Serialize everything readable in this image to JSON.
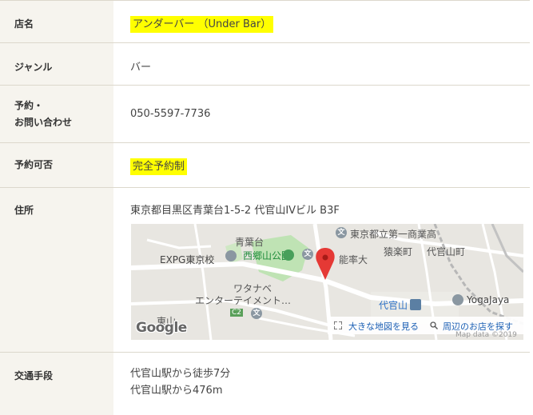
{
  "rows": {
    "shop_name": {
      "label": "店名",
      "value": "アンダーバー （Under Bar）"
    },
    "genre": {
      "label": "ジャンル",
      "value": "バー"
    },
    "reservation": {
      "label_line1": "予約・",
      "label_line2": "お問い合わせ",
      "value": "050-5597-7736"
    },
    "availability": {
      "label": "予約可否",
      "value": "完全予約制"
    },
    "address": {
      "label": "住所",
      "value": "東京都目黒区青葉台1-5-2 代官山IVビル B3F"
    },
    "access": {
      "label": "交通手段",
      "line1": "代官山駅から徒歩7分",
      "line2": "代官山駅から476m"
    }
  },
  "map": {
    "labels": {
      "aobadai": "青葉台",
      "saigoyama_park": "西郷山公園",
      "expg": "EXPG東京校",
      "watanabe_line1": "ワタナベ",
      "watanabe_line2": "エンターテイメント…",
      "higashiyama": "東山",
      "daiichi_shogyo": "東京都立第一商業高",
      "sarugakucho": "猿楽町",
      "daikanyamacho": "代官山町",
      "nouritsu": "能率大",
      "daikanyama_station": "代官山",
      "yogajaya": "YogaJaya",
      "route_c2": "C2",
      "poi_glyph": "文"
    },
    "google": "Google",
    "larger_map": "大きな地図を見る",
    "nearby": "周辺のお店を探す",
    "map_data": "Map data ©2019"
  },
  "colors": {
    "highlight": "#ffff00",
    "header_bg": "#f6f4ee",
    "border": "#dcd8cc",
    "pin": "#e53935",
    "park": "#bfe3b4"
  }
}
